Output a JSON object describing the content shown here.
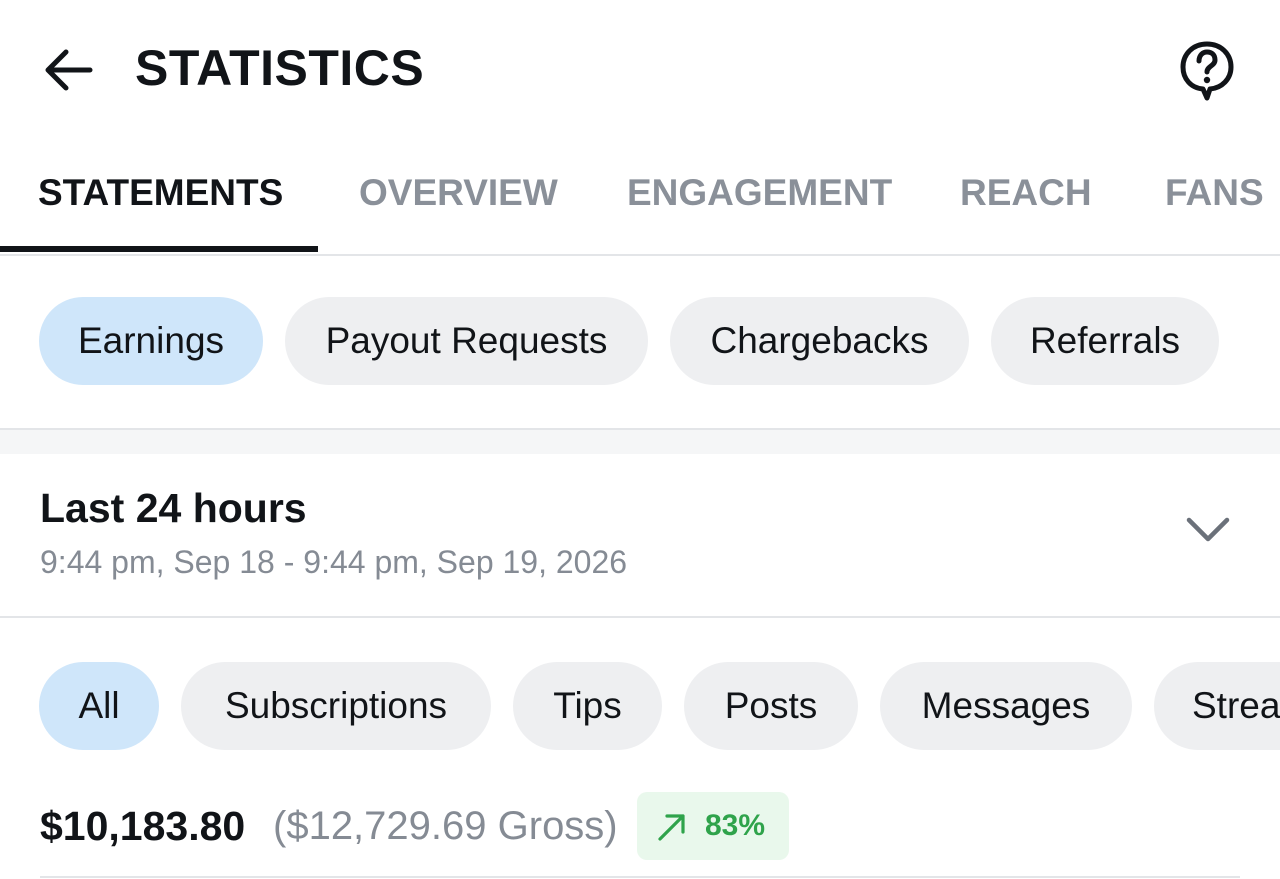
{
  "header": {
    "title": "STATISTICS",
    "back_icon": "arrow-left-icon",
    "help_icon": "question-bubble-icon"
  },
  "tabs": [
    {
      "label": "STATEMENTS",
      "active": true
    },
    {
      "label": "OVERVIEW",
      "active": false
    },
    {
      "label": "ENGAGEMENT",
      "active": false
    },
    {
      "label": "REACH",
      "active": false
    },
    {
      "label": "FANS",
      "active": false
    }
  ],
  "statement_types": [
    {
      "label": "Earnings",
      "selected": true
    },
    {
      "label": "Payout Requests",
      "selected": false
    },
    {
      "label": "Chargebacks",
      "selected": false
    },
    {
      "label": "Referrals",
      "selected": false
    }
  ],
  "date_range": {
    "title": "Last 24 hours",
    "subtitle": "9:44 pm, Sep 18 - 9:44 pm, Sep 19, 2026",
    "icon": "chevron-down-icon"
  },
  "earning_categories": [
    {
      "label": "All",
      "selected": true
    },
    {
      "label": "Subscriptions",
      "selected": false
    },
    {
      "label": "Tips",
      "selected": false
    },
    {
      "label": "Posts",
      "selected": false
    },
    {
      "label": "Messages",
      "selected": false
    },
    {
      "label": "Strea",
      "selected": false
    }
  ],
  "totals": {
    "net": "$10,183.80",
    "gross": "($12,729.69 Gross)",
    "trend_percent": "83%",
    "trend_icon": "trend-up-arrow-icon"
  },
  "colors": {
    "text_primary": "#111418",
    "text_secondary": "#858b94",
    "tab_inactive": "#8a9099",
    "chip_bg": "#eeeff1",
    "chip_selected_bg": "#cfe6fa",
    "trend_green": "#2fa34b",
    "trend_bg": "#e9f8ec"
  }
}
